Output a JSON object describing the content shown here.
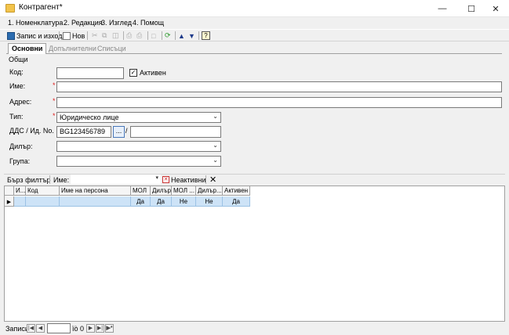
{
  "window": {
    "title": "Контрагент*"
  },
  "menu": [
    "1. Номенклатура",
    "2. Редакция",
    "3. Изглед",
    "4. Помощ"
  ],
  "toolbar": {
    "save_exit": "Запис и изход",
    "new": "Нов"
  },
  "tabs": [
    "Основни",
    "Допълнителни",
    "Списъци"
  ],
  "form": {
    "group": "Общи",
    "code_label": "Код:",
    "code_value": "",
    "active_label": "Активен",
    "active_checked": true,
    "name_label": "Име:",
    "address_label": "Адрес:",
    "type_label": "Тип:",
    "type_value": "Юридическо лице",
    "vat_label": "ДДС / Ид. No.",
    "vat_value": "BG123456789",
    "vat_btn": "...",
    "vat_sep": "/",
    "dealer_label": "Дилър:",
    "group_label": "Група:"
  },
  "filterbar": {
    "quick": "Бърз филтър",
    "name_label": "Име:",
    "inactive": "Неактивни"
  },
  "grid": {
    "columns": [
      "И...",
      "Код",
      "Име на персона",
      "МОЛ",
      "Дилър",
      "МОЛ ...",
      "Дилър...",
      "Активен"
    ],
    "row": [
      "",
      "",
      "",
      "Да",
      "Да",
      "Не",
      "Не",
      "Да"
    ]
  },
  "status": {
    "records": "Записи:",
    "position": "ïò 0"
  }
}
